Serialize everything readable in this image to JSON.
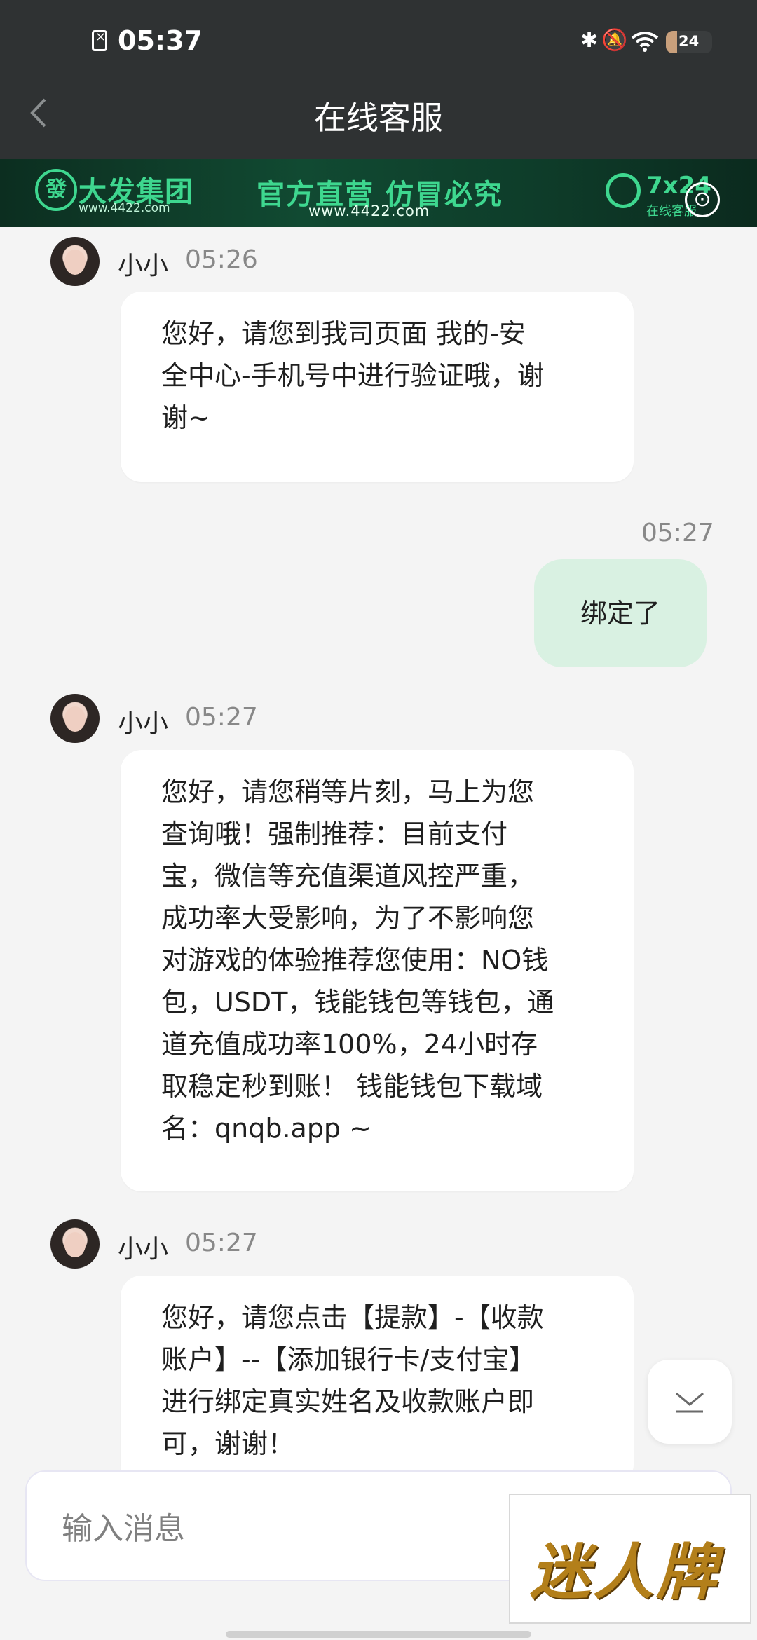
{
  "status_bar": {
    "time": "05:37",
    "battery": "24",
    "battery_level": 0.24
  },
  "header": {
    "title": "在线客服"
  },
  "banner": {
    "emblem": "發",
    "brand": "大发集团",
    "brand_url": "www.4422.com",
    "slogan": "官方直营  仿冒必究",
    "slogan_url": "www.4422.com",
    "hours": "7x24",
    "cs_label": "在线客服"
  },
  "messages": [
    {
      "name": "小小",
      "time": "05:26",
      "text": "您好，请您到我司页面 我的-安\n全中心-手机号中进行验证哦，谢\n谢~"
    },
    {
      "time": "05:27",
      "text": "绑定了",
      "mine": true
    },
    {
      "name": "小小",
      "time": "05:27",
      "text": "您好，请您稍等片刻，马上为您\n查询哦！强制推荐：目前支付\n宝，微信等充值渠道风控严重，\n成功率大受影响，为了不影响您\n对游戏的体验推荐您使用：NO钱\n包，USDT，钱能钱包等钱包，通\n道充值成功率100%，24小时存\n取稳定秒到账！ 钱能钱包下载域\n名：qnqb.app ~"
    },
    {
      "name": "小小",
      "time": "05:27",
      "text": "您好，请您点击【提款】-【收款\n账户】--【添加银行卡/支付宝】\n进行绑定真实姓名及收款账户即\n可，谢谢！"
    }
  ],
  "input": {
    "placeholder": "输入消息"
  },
  "ad": {
    "text": "迷人牌"
  }
}
